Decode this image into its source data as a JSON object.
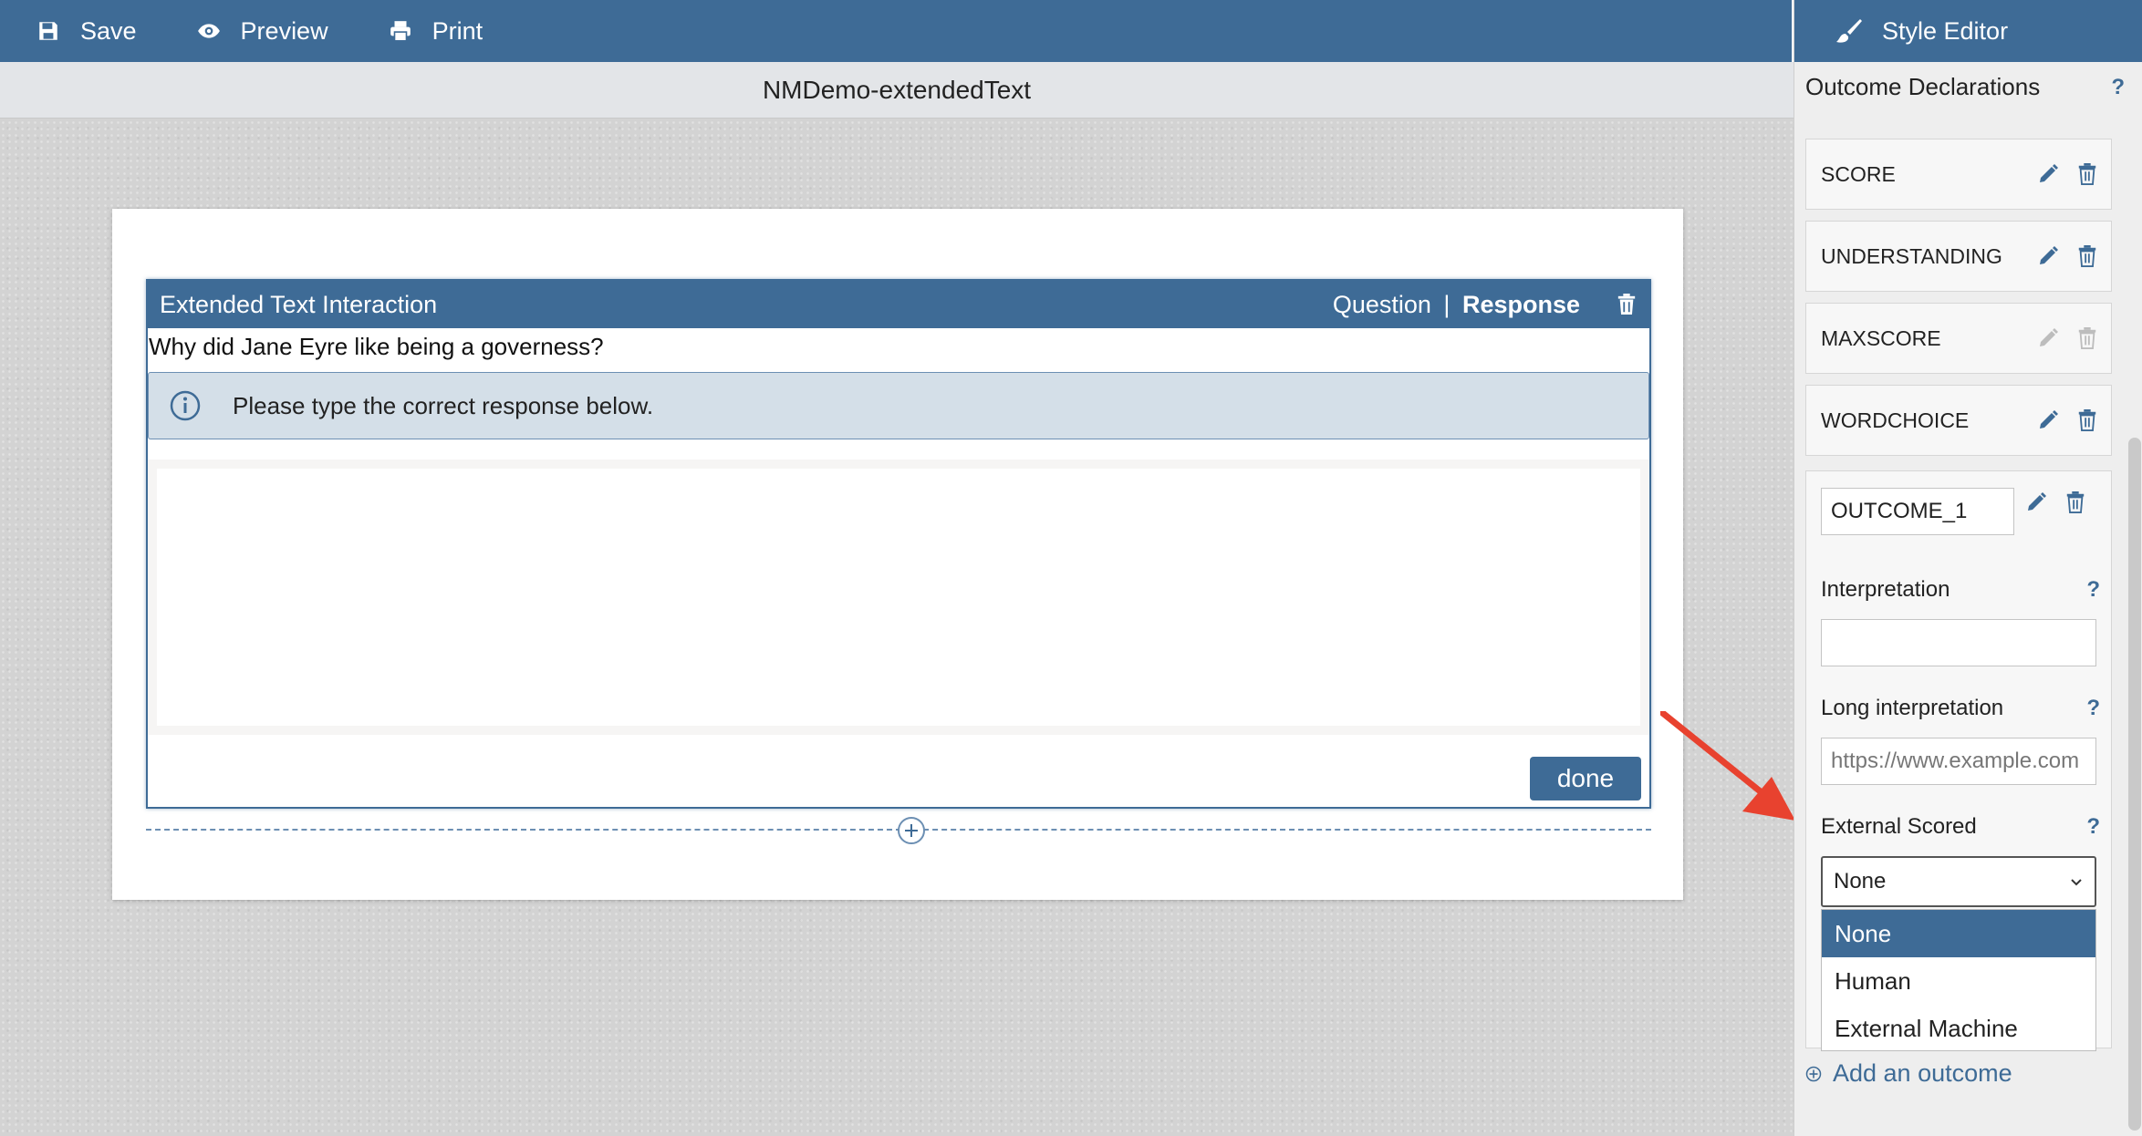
{
  "toolbar": {
    "save_label": "Save",
    "preview_label": "Preview",
    "print_label": "Print"
  },
  "document": {
    "title": "NMDemo-extendedText"
  },
  "interaction": {
    "header_title": "Extended Text Interaction",
    "question_label": "Question",
    "separator": "|",
    "response_label": "Response",
    "prompt": "Why did Jane Eyre like being a governess?",
    "notice": "Please type the correct response below.",
    "done_label": "done"
  },
  "panel": {
    "header_title": "Style Editor",
    "section_title": "Outcome Declarations",
    "help_glyph": "?",
    "outcomes": [
      {
        "name": "SCORE"
      },
      {
        "name": "UNDERSTANDING"
      },
      {
        "name": "MAXSCORE"
      },
      {
        "name": "WORDCHOICE"
      }
    ],
    "expanded": {
      "identifier": "OUTCOME_1",
      "interpretation_label": "Interpretation",
      "interpretation_value": "",
      "long_interpretation_label": "Long interpretation",
      "long_interpretation_placeholder": "https://www.example.com",
      "external_scored_label": "External Scored",
      "external_scored_value": "None",
      "options": [
        "None",
        "Human",
        "External Machine"
      ]
    },
    "add_outcome_label": "Add an outcome"
  },
  "colors": {
    "accent": "#3e6b96",
    "arrow": "#e8422f"
  }
}
